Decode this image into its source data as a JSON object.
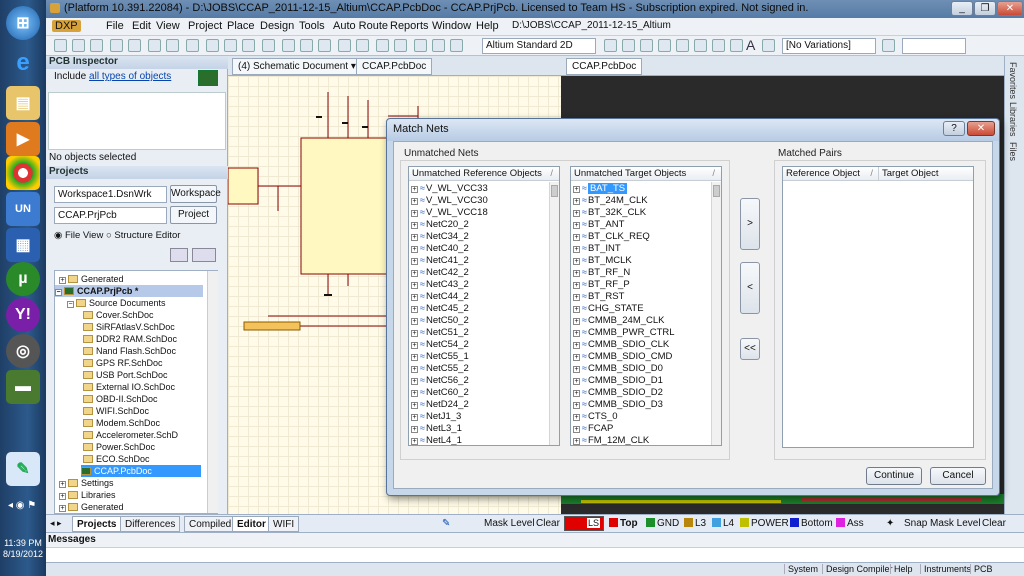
{
  "window": {
    "title": "(Platform 10.391.22084) - D:\\JOBS\\CCAP_2011-12-15_Altium\\CCAP.PcbDoc - CCAP.PrjPcb. Licensed to Team HS - Subscription expired. Not signed in."
  },
  "menu": {
    "items": [
      "DXP",
      "File",
      "Edit",
      "View",
      "Project",
      "Place",
      "Design",
      "Tools",
      "Auto Route",
      "Reports",
      "Window",
      "Help"
    ],
    "path": "D:\\JOBS\\CCAP_2011-12-15_Altium"
  },
  "toolbar": {
    "view_combo": "Altium Standard 2D",
    "variations_combo": "[No Variations]"
  },
  "inspector": {
    "header": "PCB Inspector",
    "include_text": "Include",
    "include_link": "all types of objects",
    "no_objects": "No objects selected"
  },
  "projects": {
    "header": "Projects",
    "workspace": "Workspace1.DsnWrk",
    "workspace_btn": "Workspace",
    "project": "CCAP.PrjPcb",
    "project_btn": "Project",
    "file_view": "File View",
    "structure_editor": "Structure Editor",
    "tree": [
      "Generated",
      "CCAP.PrjPcb *",
      "Source Documents",
      "Cover.SchDoc",
      "SiRFAtlasV.SchDoc",
      "DDR2 RAM.SchDoc",
      "Nand Flash.SchDoc",
      "GPS RF.SchDoc",
      "USB Port.SchDoc",
      "External IO.SchDoc",
      "OBD-II.SchDoc",
      "WIFI.SchDoc",
      "Modem.SchDoc",
      "Accelerometer.SchD",
      "Power.SchDoc",
      "ECO.SchDoc",
      "CCAP.PcbDoc",
      "Settings",
      "Libraries",
      "Generated"
    ]
  },
  "doctabs": {
    "schematic": "(4) Schematic Document",
    "pcb1": "CCAP.PcbDoc",
    "pcb2": "CCAP.PcbDoc"
  },
  "dialog": {
    "title": "Match Nets",
    "unmatched_nets_label": "Unmatched Nets",
    "matched_pairs_label": "Matched Pairs",
    "ref_header": "Unmatched Reference Objects",
    "target_header": "Unmatched Target Objects",
    "pair_ref_header": "Reference Object",
    "pair_target_header": "Target Object",
    "reference_objects": [
      "V_WL_VCC33",
      "V_WL_VCC30",
      "V_WL_VCC18",
      "NetC20_2",
      "NetC34_2",
      "NetC40_2",
      "NetC41_2",
      "NetC42_2",
      "NetC43_2",
      "NetC44_2",
      "NetC45_2",
      "NetC50_2",
      "NetC51_2",
      "NetC54_2",
      "NetC55_1",
      "NetC55_2",
      "NetC56_2",
      "NetC60_2",
      "NetD24_2",
      "NetJ1_3",
      "NetL3_1",
      "NetL4_1"
    ],
    "target_objects": [
      "BAT_TS",
      "BT_24M_CLK",
      "BT_32K_CLK",
      "BT_ANT",
      "BT_CLK_REQ",
      "BT_INT",
      "BT_MCLK",
      "BT_RF_N",
      "BT_RF_P",
      "BT_RST",
      "CHG_STATE",
      "CMMB_24M_CLK",
      "CMMB_PWR_CTRL",
      "CMMB_SDIO_CLK",
      "CMMB_SDIO_CMD",
      "CMMB_SDIO_D0",
      "CMMB_SDIO_D1",
      "CMMB_SDIO_D2",
      "CMMB_SDIO_D3",
      "CTS_0",
      "FCAP",
      "FM_12M_CLK"
    ],
    "btn_add": ">",
    "btn_remove": "<",
    "btn_remove_all": "<<",
    "continue": "Continue",
    "cancel": "Cancel"
  },
  "bottom": {
    "tab_projects": "Projects",
    "tab_differences": "Differences",
    "tab_compiled": "Compiled",
    "tab_editor": "Editor",
    "tab_wifi": "WIFI",
    "mask_level": "Mask Level",
    "clear": "Clear",
    "layers": [
      {
        "name": "LS",
        "color": "#e00000"
      },
      {
        "name": "Top",
        "color": "#e00000"
      },
      {
        "name": "GND",
        "color": "#1a8f2a"
      },
      {
        "name": "L3",
        "color": "#b8860b"
      },
      {
        "name": "L4",
        "color": "#40a0e0"
      },
      {
        "name": "POWER",
        "color": "#c0c000"
      },
      {
        "name": "Bottom",
        "color": "#1020d0"
      },
      {
        "name": "Ass",
        "color": "#e020e0"
      }
    ],
    "snap": "Snap",
    "mask_level2": "Mask Level",
    "clear2": "Clear"
  },
  "messages": {
    "header": "Messages"
  },
  "status": {
    "items": [
      "System",
      "Design Compiler",
      "Help",
      "Instruments",
      "PCB"
    ]
  },
  "clock": {
    "time": "11:39 PM",
    "date": "8/19/2012"
  },
  "right_strip": [
    "Favorites",
    "Libraries",
    "Files"
  ]
}
